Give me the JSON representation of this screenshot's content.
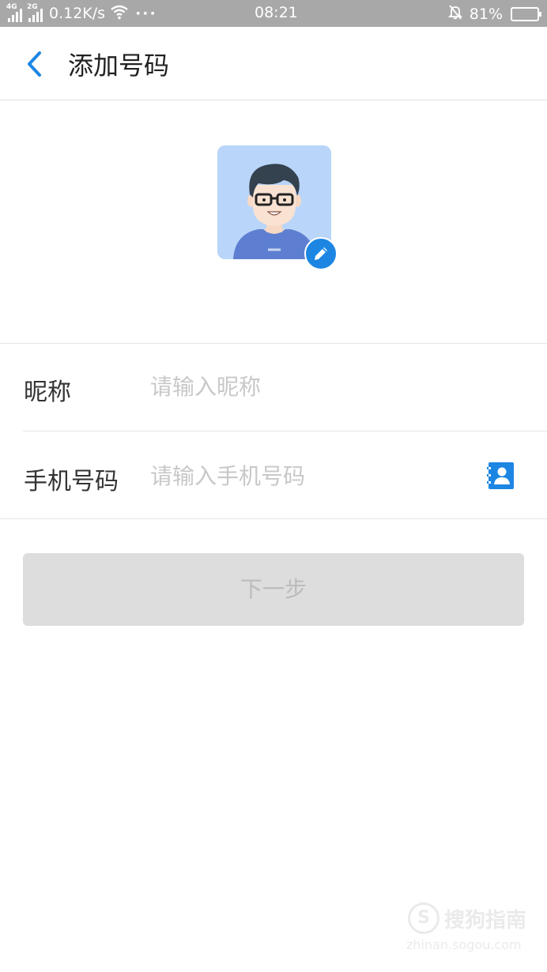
{
  "status_bar": {
    "net1": "4G",
    "net2": "2G",
    "speed": "0.12K/s",
    "more": "···",
    "time": "08:21",
    "battery_pct": "81%",
    "battery_level": 0.81
  },
  "header": {
    "title": "添加号码"
  },
  "form": {
    "nickname_label": "昵称",
    "nickname_placeholder": "请输入昵称",
    "nickname_value": "",
    "phone_label": "手机号码",
    "phone_placeholder": "请输入手机号码",
    "phone_value": ""
  },
  "actions": {
    "next_label": "下一步"
  },
  "watermark": {
    "logo": "S",
    "name": "搜狗指南",
    "url": "zhinan.sogou.com"
  },
  "colors": {
    "accent": "#1d86e3",
    "status_bar_bg": "#a8a8a8",
    "button_disabled_bg": "#dddddd",
    "avatar_bg": "#b9d5f9"
  },
  "icons": {
    "back": "chevron-left-icon",
    "edit": "pencil-icon",
    "contacts": "contacts-book-icon",
    "wifi": "wifi-icon",
    "bell_off": "bell-off-icon",
    "battery": "battery-icon"
  }
}
